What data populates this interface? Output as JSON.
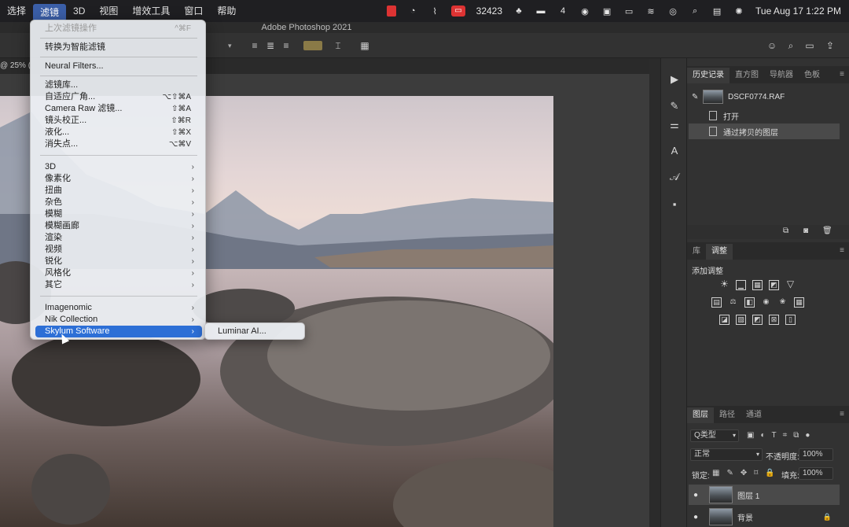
{
  "menubar": {
    "items": [
      "选择",
      "滤镜",
      "3D",
      "视图",
      "增效工具",
      "窗口",
      "帮助"
    ],
    "active_index": 1,
    "status": {
      "counter": "32423",
      "badge_number": "4",
      "datetime": "Tue Aug 17  1:22 PM"
    }
  },
  "app_title": "Adobe Photoshop 2021",
  "doc_tab_label": "@ 25% (",
  "filter_menu": {
    "last_filter": {
      "label": "上次滤镜操作",
      "shortcut": "^⌘F"
    },
    "smart": "转换为智能滤镜",
    "neural": "Neural Filters...",
    "group1": [
      {
        "label": "滤镜库...",
        "shortcut": ""
      },
      {
        "label": "自适应广角...",
        "shortcut": "⌥⇧⌘A"
      },
      {
        "label": "Camera Raw 滤镜...",
        "shortcut": "⇧⌘A"
      },
      {
        "label": "镜头校正...",
        "shortcut": "⇧⌘R"
      },
      {
        "label": "液化...",
        "shortcut": "⇧⌘X"
      },
      {
        "label": "消失点...",
        "shortcut": "⌥⌘V"
      }
    ],
    "group2": [
      "3D",
      "像素化",
      "扭曲",
      "杂色",
      "模糊",
      "模糊画廊",
      "渲染",
      "视频",
      "锐化",
      "风格化",
      "其它"
    ],
    "group3": [
      "Imagenomic",
      "Nik Collection",
      "Skylum Software"
    ],
    "highlighted": "Skylum Software"
  },
  "submenu": {
    "item": "Luminar AI..."
  },
  "history_panel": {
    "tabs": [
      "历史记录",
      "直方图",
      "导航器",
      "色板"
    ],
    "snapshot": "DSCF0774.RAF",
    "steps": [
      "打开",
      "通过拷贝的图层"
    ]
  },
  "adjust_panel": {
    "tabs": [
      "库",
      "调整"
    ],
    "heading": "添加调整"
  },
  "layers_panel": {
    "tabs": [
      "图层",
      "路径",
      "通道"
    ],
    "filter_label": "Q类型",
    "blend_mode": "正常",
    "opacity_label": "不透明度:",
    "opacity_value": "100%",
    "lock_label": "锁定:",
    "fill_label": "填充:",
    "fill_value": "100%",
    "layers": [
      "图层 1",
      "背景"
    ]
  },
  "colors": {
    "menu_highlight": "#2d6fd6",
    "menubar_active": "#3b5fa8",
    "panel_bg": "#323232"
  }
}
